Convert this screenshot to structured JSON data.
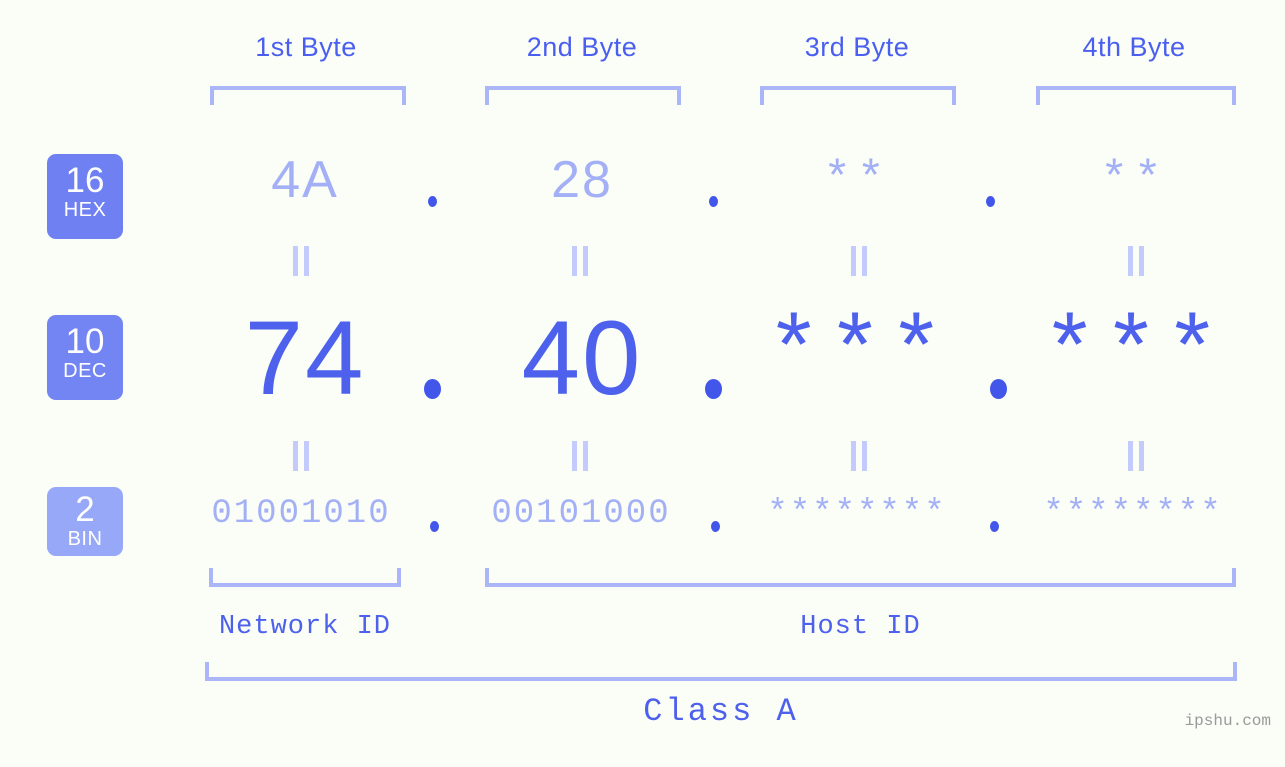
{
  "meta": {
    "background_color": "#fbfdf7",
    "accent_strong": "#4d61ec",
    "accent_light": "#a3b0f6",
    "bracket_color": "#aab6f8",
    "watermark": "ipshu.com"
  },
  "byte_headers": [
    {
      "label": "1st Byte"
    },
    {
      "label": "2nd Byte"
    },
    {
      "label": "3rd Byte"
    },
    {
      "label": "4th Byte"
    }
  ],
  "rows": {
    "hex": {
      "badge_number": "16",
      "badge_name": "HEX",
      "values": [
        "4A",
        "28",
        "**",
        "**"
      ],
      "separator": "."
    },
    "dec": {
      "badge_number": "10",
      "badge_name": "DEC",
      "values": [
        "74",
        "40",
        "***",
        "***"
      ],
      "separator": "."
    },
    "bin": {
      "badge_number": "2",
      "badge_name": "BIN",
      "values": [
        "01001010",
        "00101000",
        "********",
        "********"
      ],
      "separator": "."
    }
  },
  "id_labels": {
    "network": "Network ID",
    "host": "Host ID"
  },
  "class_label": "Class A",
  "chart_data": {
    "type": "table",
    "title": "Class A",
    "columns": [
      "1st Byte",
      "2nd Byte",
      "3rd Byte",
      "4th Byte"
    ],
    "rows": [
      {
        "base": "16",
        "name": "HEX",
        "values": [
          "4A",
          "28",
          "**",
          "**"
        ]
      },
      {
        "base": "10",
        "name": "DEC",
        "values": [
          "74",
          "40",
          "***",
          "***"
        ]
      },
      {
        "base": "2",
        "name": "BIN",
        "values": [
          "01001010",
          "00101000",
          "********",
          "********"
        ]
      }
    ],
    "annotations": [
      "Network ID",
      "Host ID",
      "Class A"
    ]
  }
}
